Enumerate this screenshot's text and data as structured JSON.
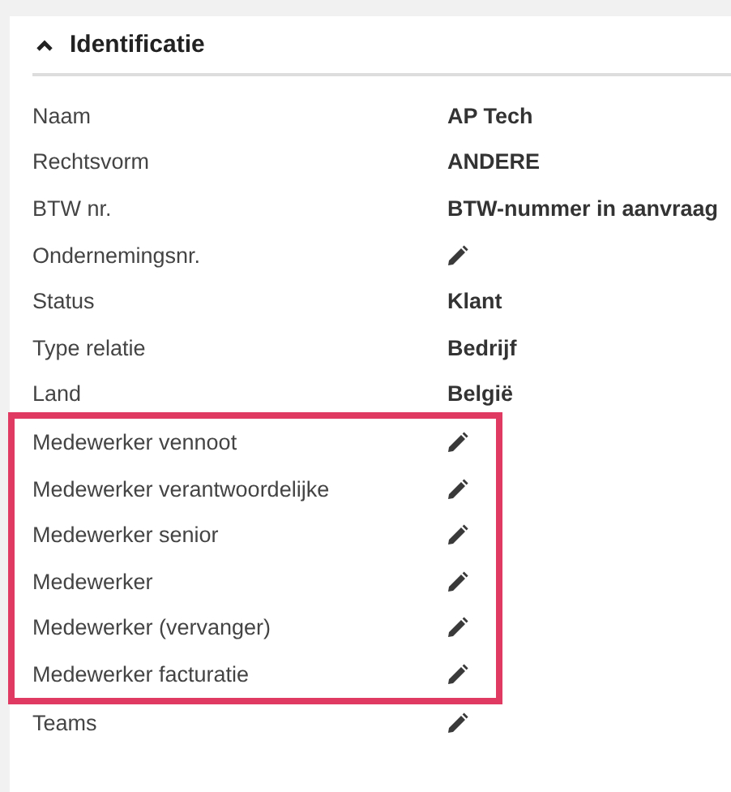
{
  "section": {
    "title": "Identificatie",
    "expanded": true
  },
  "rows": [
    {
      "label": "Naam",
      "kind": "text",
      "value": "AP Tech",
      "highlighted": false
    },
    {
      "label": "Rechtsvorm",
      "kind": "text",
      "value": "ANDERE",
      "highlighted": false
    },
    {
      "label": "BTW nr.",
      "kind": "text",
      "value": "BTW-nummer in aanvraag",
      "highlighted": false
    },
    {
      "label": "Ondernemingsnr.",
      "kind": "edit",
      "highlighted": false
    },
    {
      "label": "Status",
      "kind": "text",
      "value": "Klant",
      "highlighted": false
    },
    {
      "label": "Type relatie",
      "kind": "text",
      "value": "Bedrijf",
      "highlighted": false
    },
    {
      "label": "Land",
      "kind": "text",
      "value": "België",
      "highlighted": false
    },
    {
      "label": "Medewerker vennoot",
      "kind": "edit",
      "highlighted": true
    },
    {
      "label": "Medewerker verantwoordelijke",
      "kind": "edit",
      "highlighted": true
    },
    {
      "label": "Medewerker senior",
      "kind": "edit",
      "highlighted": true
    },
    {
      "label": "Medewerker",
      "kind": "edit",
      "highlighted": true
    },
    {
      "label": "Medewerker (vervanger)",
      "kind": "edit",
      "highlighted": true
    },
    {
      "label": "Medewerker facturatie",
      "kind": "edit",
      "highlighted": true
    },
    {
      "label": "Teams",
      "kind": "edit",
      "highlighted": false
    }
  ]
}
